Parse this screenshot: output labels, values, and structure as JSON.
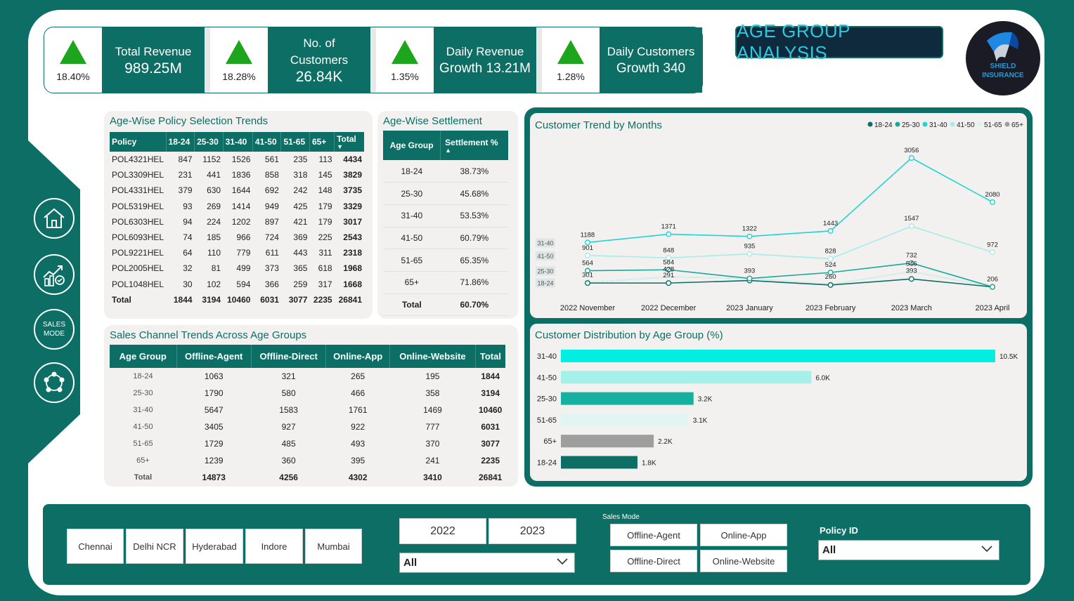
{
  "kpis": [
    {
      "pct": "18.40%",
      "line1": "Total Revenue",
      "line2": "989.25M"
    },
    {
      "pct": "18.28%",
      "line1": "No. of",
      "line2": "Customers",
      "line3": "26.84K"
    },
    {
      "pct": "1.35%",
      "line1": "Daily Revenue",
      "line2": "Growth 13.21M"
    },
    {
      "pct": "1.28%",
      "line1": "Daily Customers",
      "line2": "Growth 340"
    }
  ],
  "header_title": "AGE GROUP ANALYSIS",
  "logo": {
    "line1": "SHIELD",
    "line2": "INSURANCE"
  },
  "sidebar": {
    "sales_mode_line1": "SALES",
    "sales_mode_line2": "MODE"
  },
  "policy_table": {
    "title": "Age-Wise Policy Selection Trends",
    "headers": [
      "Policy",
      "18-24",
      "25-30",
      "31-40",
      "41-50",
      "51-65",
      "65+",
      "Total"
    ],
    "rows": [
      [
        "POL4321HEL",
        "847",
        "1152",
        "1526",
        "561",
        "235",
        "113",
        "4434"
      ],
      [
        "POL3309HEL",
        "231",
        "441",
        "1836",
        "858",
        "318",
        "145",
        "3829"
      ],
      [
        "POL4331HEL",
        "379",
        "630",
        "1644",
        "692",
        "242",
        "148",
        "3735"
      ],
      [
        "POL5319HEL",
        "93",
        "269",
        "1414",
        "949",
        "425",
        "179",
        "3329"
      ],
      [
        "POL6303HEL",
        "94",
        "224",
        "1202",
        "897",
        "421",
        "179",
        "3017"
      ],
      [
        "POL6093HEL",
        "74",
        "185",
        "966",
        "724",
        "369",
        "225",
        "2543"
      ],
      [
        "POL9221HEL",
        "64",
        "110",
        "779",
        "611",
        "443",
        "311",
        "2318"
      ],
      [
        "POL2005HEL",
        "32",
        "81",
        "499",
        "373",
        "365",
        "618",
        "1968"
      ],
      [
        "POL1048HEL",
        "30",
        "102",
        "594",
        "366",
        "259",
        "317",
        "1668"
      ]
    ],
    "total": [
      "Total",
      "1844",
      "3194",
      "10460",
      "6031",
      "3077",
      "2235",
      "26841"
    ]
  },
  "settlement_table": {
    "title": "Age-Wise Settlement",
    "headers": [
      "Age Group",
      "Settlement %"
    ],
    "rows": [
      [
        "18-24",
        "38.73%"
      ],
      [
        "25-30",
        "45.68%"
      ],
      [
        "31-40",
        "53.53%"
      ],
      [
        "41-50",
        "60.79%"
      ],
      [
        "51-65",
        "65.35%"
      ],
      [
        "65+",
        "71.86%"
      ]
    ],
    "total": [
      "Total",
      "60.70%"
    ]
  },
  "channel_table": {
    "title": "Sales Channel Trends Across Age Groups",
    "headers": [
      "Age Group",
      "Offline-Agent",
      "Offline-Direct",
      "Online-App",
      "Online-Website",
      "Total"
    ],
    "rows": [
      [
        "18-24",
        "1063",
        "321",
        "265",
        "195",
        "1844"
      ],
      [
        "25-30",
        "1790",
        "580",
        "466",
        "358",
        "3194"
      ],
      [
        "31-40",
        "5647",
        "1583",
        "1761",
        "1469",
        "10460"
      ],
      [
        "41-50",
        "3405",
        "927",
        "922",
        "777",
        "6031"
      ],
      [
        "51-65",
        "1729",
        "485",
        "493",
        "370",
        "3077"
      ],
      [
        "65+",
        "1239",
        "360",
        "395",
        "241",
        "2235"
      ]
    ],
    "total": [
      "Total",
      "14873",
      "4256",
      "4302",
      "3410",
      "26841"
    ]
  },
  "chart_data": [
    {
      "type": "line",
      "title": "Customer Trend by Months",
      "categories": [
        "2022 November",
        "2022 December",
        "2023 January",
        "2023 February",
        "2023 March",
        "2023 April"
      ],
      "legend_position": "top-right",
      "series": [
        {
          "name": "18-24",
          "color": "#0c6e64",
          "values": [
            291,
            291,
            346,
            247,
            381,
            206
          ]
        },
        {
          "name": "25-30",
          "color": "#19a89a",
          "values": [
            564,
            584,
            393,
            524,
            732,
            206
          ]
        },
        {
          "name": "31-40",
          "color": "#21d4d4",
          "values": [
            1188,
            1371,
            1322,
            1443,
            3056,
            2080
          ]
        },
        {
          "name": "41-50",
          "color": "#a8ece8",
          "values": [
            901,
            848,
            935,
            828,
            1547,
            972
          ]
        },
        {
          "name": "51-65",
          "color": "#d9f3f0",
          "values": [
            301,
            428,
            393,
            260,
            546,
            206
          ]
        },
        {
          "name": "65+",
          "color": "#9e9e9e",
          "values": [
            301,
            428,
            393,
            260,
            546,
            206
          ]
        }
      ],
      "labels": [
        {
          "text": "1188",
          "ci": 0,
          "v": 1188
        },
        {
          "text": "1371",
          "ci": 1,
          "v": 1371
        },
        {
          "text": "1322",
          "ci": 2,
          "v": 1322
        },
        {
          "text": "1443",
          "ci": 3,
          "v": 1443
        },
        {
          "text": "3056",
          "ci": 4,
          "v": 3056
        },
        {
          "text": "2080",
          "ci": 5,
          "v": 2080
        },
        {
          "text": "901",
          "ci": 0,
          "v": 901
        },
        {
          "text": "848",
          "ci": 1,
          "v": 848
        },
        {
          "text": "935",
          "ci": 2,
          "v": 935
        },
        {
          "text": "828",
          "ci": 3,
          "v": 828
        },
        {
          "text": "1547",
          "ci": 4,
          "v": 1547
        },
        {
          "text": "972",
          "ci": 5,
          "v": 972
        },
        {
          "text": "564",
          "ci": 0,
          "v": 564
        },
        {
          "text": "584",
          "ci": 1,
          "v": 584
        },
        {
          "text": "393",
          "ci": 2,
          "v": 393
        },
        {
          "text": "524",
          "ci": 3,
          "v": 524
        },
        {
          "text": "732",
          "ci": 4,
          "v": 732
        },
        {
          "text": "301",
          "ci": 0,
          "v": 301
        },
        {
          "text": "428",
          "ci": 1,
          "v": 428
        },
        {
          "text": "291",
          "ci": 1,
          "v": 291
        },
        {
          "text": "260",
          "ci": 3,
          "v": 260
        },
        {
          "text": "546",
          "ci": 4,
          "v": 546
        },
        {
          "text": "393",
          "ci": 4,
          "v": 393
        },
        {
          "text": "206",
          "ci": 5,
          "v": 206
        }
      ],
      "axis_tags": [
        "31-40",
        "41-50",
        "25-30",
        "18-24"
      ]
    },
    {
      "type": "bar",
      "orientation": "horizontal",
      "title": "Customer Distribution by Age Group (%)",
      "categories": [
        "31-40",
        "41-50",
        "25-30",
        "51-65",
        "65+",
        "18-24"
      ],
      "values": [
        10460,
        6031,
        3194,
        3077,
        2235,
        1844
      ],
      "labels": [
        "10.5K",
        "6.0K",
        "3.2K",
        "3.1K",
        "2.2K",
        "1.8K"
      ],
      "colors": [
        "#00efe0",
        "#a6f0ea",
        "#16b0a0",
        "#e2f5f2",
        "#9e9e9e",
        "#0c6e64"
      ]
    }
  ],
  "filters": {
    "cities": [
      "Chennai",
      "Delhi NCR",
      "Hyderabad",
      "Indore",
      "Mumbai"
    ],
    "years": [
      "2022",
      "2023"
    ],
    "year_dropdown": "All",
    "sales_mode_label": "Sales Mode",
    "sales_modes": [
      "Offline-Agent",
      "Online-App",
      "Offline-Direct",
      "Online-Website"
    ],
    "policy_label": "Policy ID",
    "policy_dropdown": "All"
  }
}
